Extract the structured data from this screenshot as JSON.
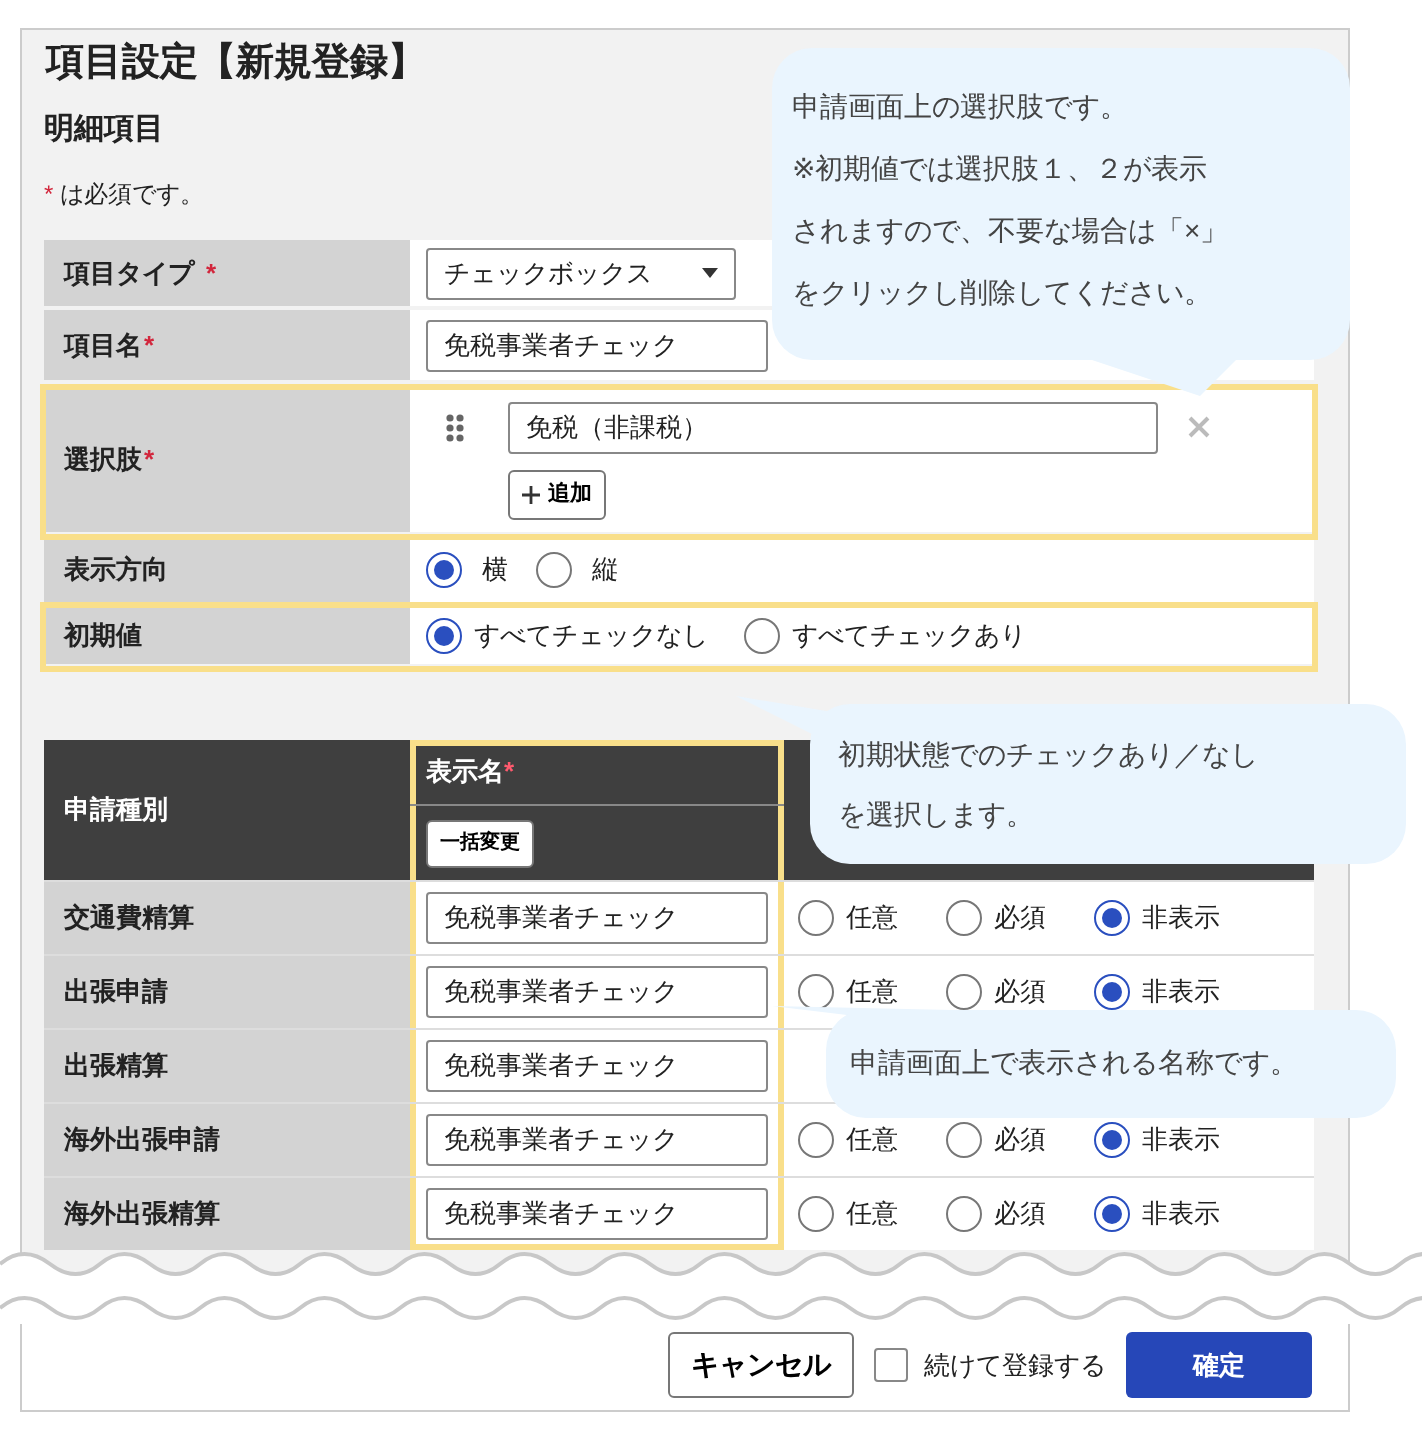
{
  "title": "項目設定【新規登録】",
  "section": "明細項目",
  "required_note": {
    "mark": "*",
    "text": "は必須です。"
  },
  "fields": [
    {
      "kind": "select",
      "label": "項目タイプ",
      "required": true,
      "highlighted": false,
      "value": "チェックボックス"
    },
    {
      "kind": "text",
      "label": "項目名",
      "required": true,
      "highlighted": false,
      "value": "免税事業者チェック"
    },
    {
      "kind": "options",
      "label": "選択肢",
      "required": true,
      "highlighted": true,
      "options": [
        {
          "value": "免税（非課税）"
        }
      ],
      "add_button": "追加"
    },
    {
      "kind": "radio",
      "label": "表示方向",
      "required": false,
      "highlighted": false,
      "choices": [
        {
          "label": "横",
          "selected": true
        },
        {
          "label": "縦",
          "selected": false
        }
      ]
    },
    {
      "kind": "radio",
      "label": "初期値",
      "required": false,
      "highlighted": true,
      "choices": [
        {
          "label": "すべてチェックなし",
          "selected": true
        },
        {
          "label": "すべてチェックあり",
          "selected": false
        }
      ]
    }
  ],
  "table": {
    "columns": [
      {
        "label": "申請種別",
        "required": false
      },
      {
        "label": "表示名",
        "required": true,
        "button": "一括変更",
        "highlighted": true
      }
    ],
    "rows": [
      {
        "type": "交通費精算",
        "display_name": "免税事業者チェック",
        "choices": [
          {
            "label": "任意",
            "selected": false
          },
          {
            "label": "必須",
            "selected": false
          },
          {
            "label": "非表示",
            "selected": true
          }
        ]
      },
      {
        "type": "出張申請",
        "display_name": "免税事業者チェック",
        "choices": [
          {
            "label": "任意",
            "selected": false
          },
          {
            "label": "必須",
            "selected": false
          },
          {
            "label": "非表示",
            "selected": true
          }
        ]
      },
      {
        "type": "出張精算",
        "display_name": "免税事業者チェック"
      },
      {
        "type": "海外出張申請",
        "display_name": "免税事業者チェック",
        "choices": [
          {
            "label": "任意",
            "selected": false
          },
          {
            "label": "必須",
            "selected": false
          },
          {
            "label": "非表示",
            "selected": true
          }
        ]
      },
      {
        "type": "海外出張精算",
        "display_name": "免税事業者チェック",
        "choices": [
          {
            "label": "任意",
            "selected": false
          },
          {
            "label": "必須",
            "selected": false
          },
          {
            "label": "非表示",
            "selected": true
          }
        ]
      }
    ]
  },
  "footer": {
    "cancel": "キャンセル",
    "continue": {
      "label": "続けて登録する",
      "checked": false
    },
    "confirm": "確定"
  },
  "callouts": [
    {
      "lines": [
        "申請画面上の選択肢です。",
        "※初期値では選択肢１、２が表示",
        "されますので、不要な場合は「×」",
        "をクリックし削除してください。"
      ]
    },
    {
      "lines": [
        "初期状態でのチェックあり／なし",
        "を選択します。"
      ]
    },
    {
      "lines": [
        "申請画面上で表示される名称です。"
      ]
    }
  ]
}
